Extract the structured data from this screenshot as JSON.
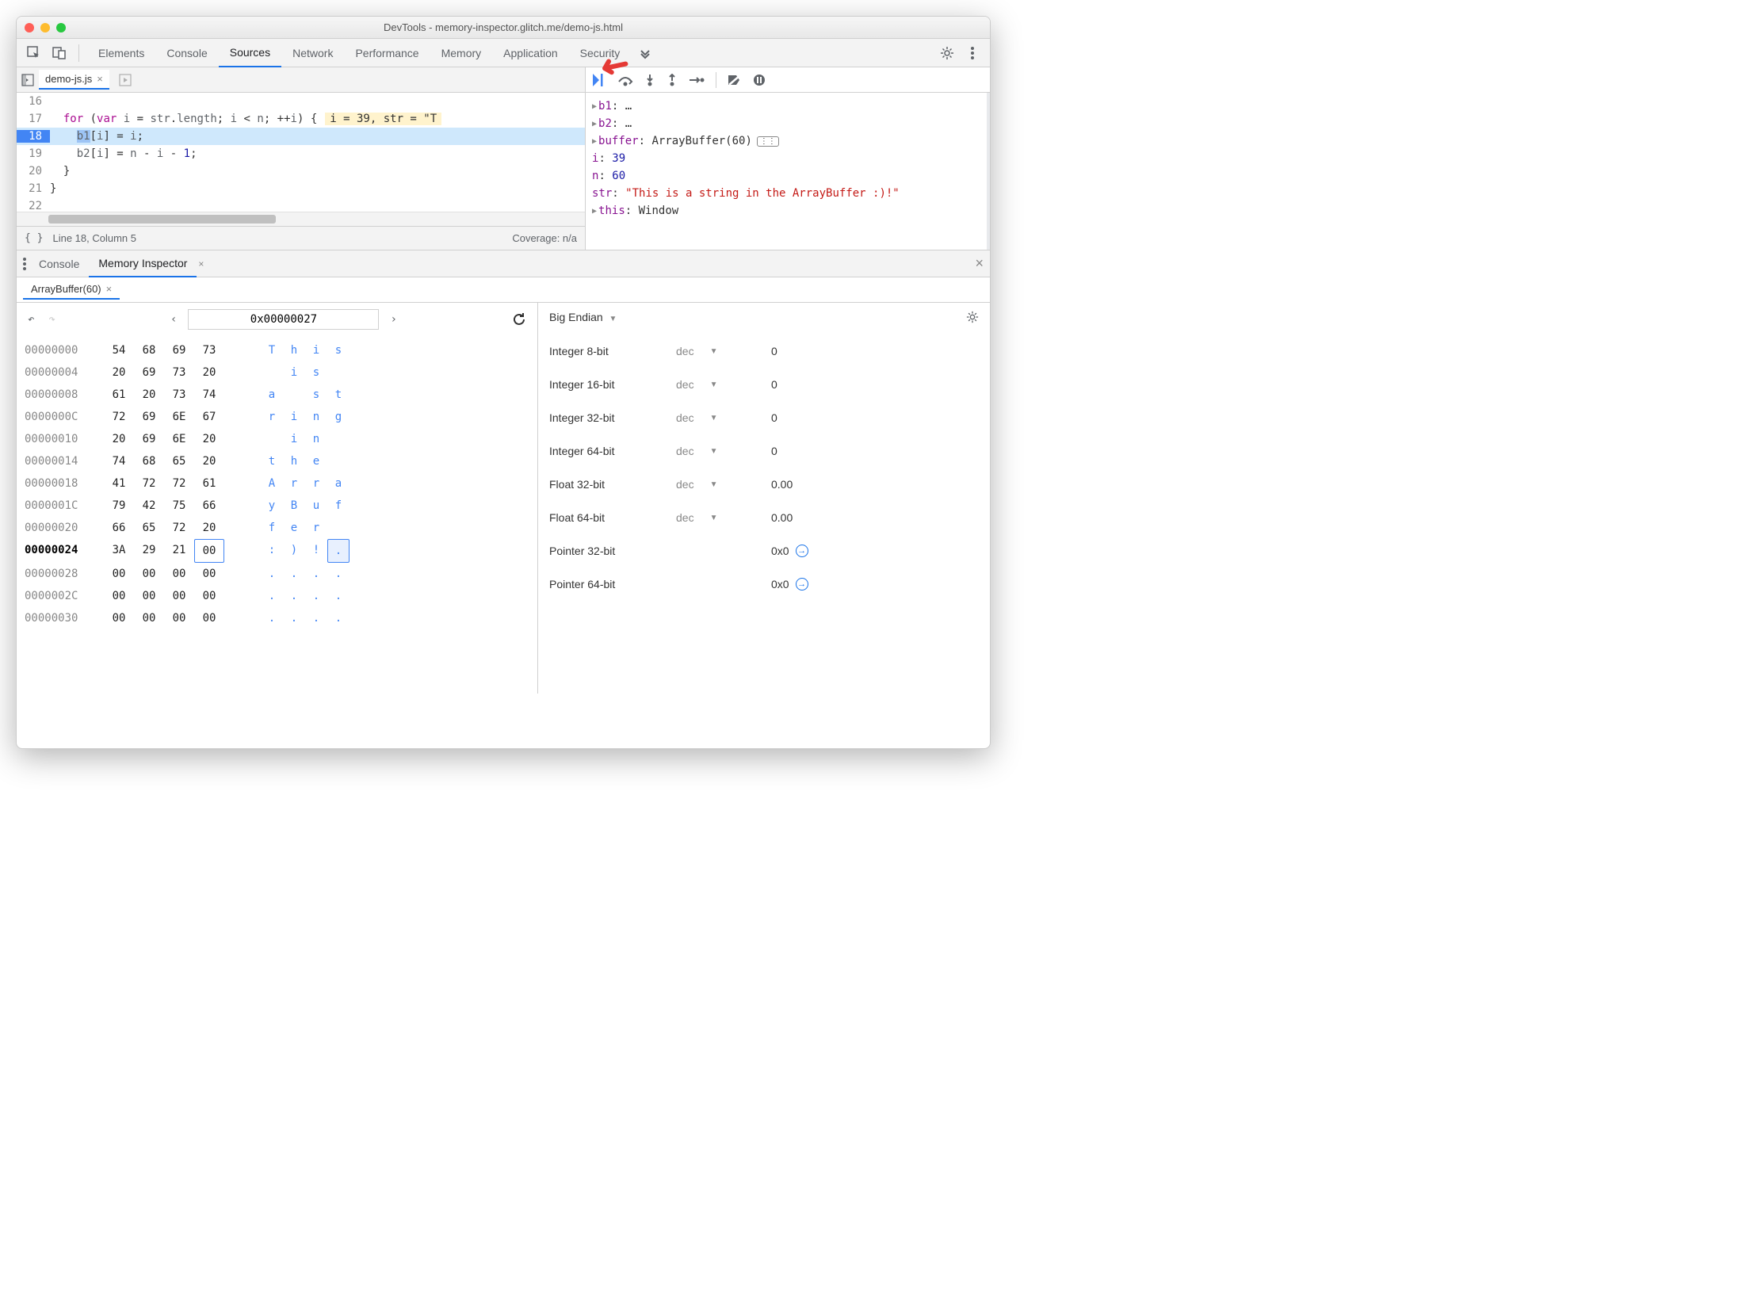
{
  "window": {
    "title": "DevTools - memory-inspector.glitch.me/demo-js.html"
  },
  "main_tabs": [
    "Elements",
    "Console",
    "Sources",
    "Network",
    "Performance",
    "Memory",
    "Application",
    "Security"
  ],
  "active_main_tab": "Sources",
  "file_tab": "demo-js.js",
  "editor": {
    "lines": [
      {
        "n": 16,
        "code": ""
      },
      {
        "n": 17,
        "code": "  for (var i = str.length; i < n; ++i) {",
        "inline": "i = 39, str = \"T"
      },
      {
        "n": 18,
        "code": "    b1[i] = i;",
        "bp": true
      },
      {
        "n": 19,
        "code": "    b2[i] = n - i - 1;"
      },
      {
        "n": 20,
        "code": "  }"
      },
      {
        "n": 21,
        "code": "}"
      },
      {
        "n": 22,
        "code": ""
      }
    ]
  },
  "status": {
    "cursor": "Line 18, Column 5",
    "coverage": "Coverage: n/a"
  },
  "scope": [
    {
      "k": "b1",
      "v": "…",
      "exp": true
    },
    {
      "k": "b2",
      "v": "…",
      "exp": true
    },
    {
      "k": "buffer",
      "v": "ArrayBuffer(60)",
      "exp": true,
      "mem": true
    },
    {
      "k": "i",
      "v": "39",
      "num": true,
      "indent": true
    },
    {
      "k": "n",
      "v": "60",
      "num": true,
      "indent": true
    },
    {
      "k": "str",
      "v": "\"This is a string in the ArrayBuffer :)!\"",
      "str": true,
      "indent": true
    },
    {
      "k": "this",
      "v": "Window",
      "exp": true
    }
  ],
  "drawer_tabs": [
    "Console",
    "Memory Inspector"
  ],
  "active_drawer_tab": "Memory Inspector",
  "mi_tab": "ArrayBuffer(60)",
  "hex": {
    "address": "0x00000027",
    "rows": [
      {
        "a": "00000000",
        "b": [
          "54",
          "68",
          "69",
          "73"
        ],
        "c": [
          "T",
          "h",
          "i",
          "s"
        ]
      },
      {
        "a": "00000004",
        "b": [
          "20",
          "69",
          "73",
          "20"
        ],
        "c": [
          " ",
          "i",
          "s",
          " "
        ]
      },
      {
        "a": "00000008",
        "b": [
          "61",
          "20",
          "73",
          "74"
        ],
        "c": [
          "a",
          " ",
          "s",
          "t"
        ]
      },
      {
        "a": "0000000C",
        "b": [
          "72",
          "69",
          "6E",
          "67"
        ],
        "c": [
          "r",
          "i",
          "n",
          "g"
        ]
      },
      {
        "a": "00000010",
        "b": [
          "20",
          "69",
          "6E",
          "20"
        ],
        "c": [
          " ",
          "i",
          "n",
          " "
        ]
      },
      {
        "a": "00000014",
        "b": [
          "74",
          "68",
          "65",
          "20"
        ],
        "c": [
          "t",
          "h",
          "e",
          " "
        ]
      },
      {
        "a": "00000018",
        "b": [
          "41",
          "72",
          "72",
          "61"
        ],
        "c": [
          "A",
          "r",
          "r",
          "a"
        ]
      },
      {
        "a": "0000001C",
        "b": [
          "79",
          "42",
          "75",
          "66"
        ],
        "c": [
          "y",
          "B",
          "u",
          "f"
        ]
      },
      {
        "a": "00000020",
        "b": [
          "66",
          "65",
          "72",
          "20"
        ],
        "c": [
          "f",
          "e",
          "r",
          " "
        ]
      },
      {
        "a": "00000024",
        "b": [
          "3A",
          "29",
          "21",
          "00"
        ],
        "c": [
          ":",
          ")",
          "!",
          "."
        ],
        "hl": 3
      },
      {
        "a": "00000028",
        "b": [
          "00",
          "00",
          "00",
          "00"
        ],
        "c": [
          ".",
          ".",
          ".",
          "."
        ]
      },
      {
        "a": "0000002C",
        "b": [
          "00",
          "00",
          "00",
          "00"
        ],
        "c": [
          ".",
          ".",
          ".",
          "."
        ]
      },
      {
        "a": "00000030",
        "b": [
          "00",
          "00",
          "00",
          "00"
        ],
        "c": [
          ".",
          ".",
          ".",
          "."
        ]
      }
    ]
  },
  "inspector": {
    "endian": "Big Endian",
    "rows": [
      {
        "t": "Integer 8-bit",
        "f": "dec",
        "v": "0"
      },
      {
        "t": "Integer 16-bit",
        "f": "dec",
        "v": "0"
      },
      {
        "t": "Integer 32-bit",
        "f": "dec",
        "v": "0"
      },
      {
        "t": "Integer 64-bit",
        "f": "dec",
        "v": "0"
      },
      {
        "t": "Float 32-bit",
        "f": "dec",
        "v": "0.00"
      },
      {
        "t": "Float 64-bit",
        "f": "dec",
        "v": "0.00"
      },
      {
        "t": "Pointer 32-bit",
        "f": "",
        "v": "0x0",
        "jump": true
      },
      {
        "t": "Pointer 64-bit",
        "f": "",
        "v": "0x0",
        "jump": true
      }
    ]
  }
}
